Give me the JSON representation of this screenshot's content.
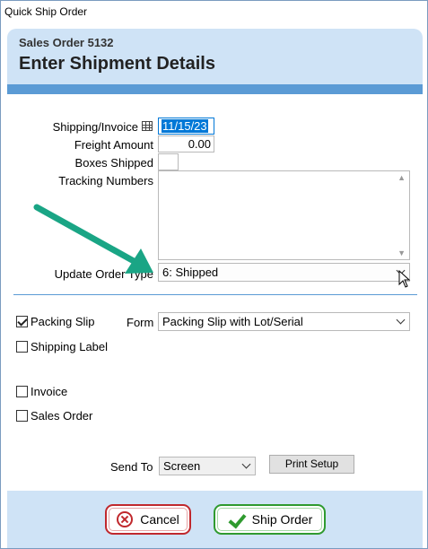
{
  "window": {
    "title": "Quick Ship Order"
  },
  "header": {
    "subtitle": "Sales Order 5132",
    "title": "Enter Shipment Details"
  },
  "form": {
    "shipping_label": "Shipping/Invoice",
    "shipping_date": "11/15/23",
    "freight_label": "Freight Amount",
    "freight_value": "0.00",
    "boxes_label": "Boxes Shipped",
    "boxes_value": "",
    "tracking_label": "Tracking Numbers",
    "tracking_value": "",
    "order_type_label": "Update Order Type",
    "order_type_value": "6: Shipped"
  },
  "print": {
    "packing_slip_label": "Packing Slip",
    "packing_slip_checked": true,
    "form_label": "Form",
    "form_value": "Packing Slip with Lot/Serial",
    "shipping_label_label": "Shipping Label",
    "shipping_label_checked": false,
    "invoice_label": "Invoice",
    "invoice_checked": false,
    "sales_order_label": "Sales Order",
    "sales_order_checked": false,
    "send_to_label": "Send To",
    "send_to_value": "Screen",
    "print_setup_label": "Print Setup"
  },
  "footer": {
    "cancel_label": "Cancel",
    "ship_label": "Ship Order"
  },
  "colors": {
    "header_bg": "#cfe3f6",
    "accent_bar": "#5b9bd5",
    "annotation_arrow": "#1aa585",
    "cancel_border": "#c0282d",
    "ship_border": "#2f9a2f"
  },
  "icons": [
    "calendar-icon",
    "chevron-down-icon",
    "scroll-up-icon",
    "scroll-down-icon",
    "cancel-x-icon",
    "checkmark-icon",
    "mouse-cursor-icon",
    "annotation-arrow"
  ]
}
